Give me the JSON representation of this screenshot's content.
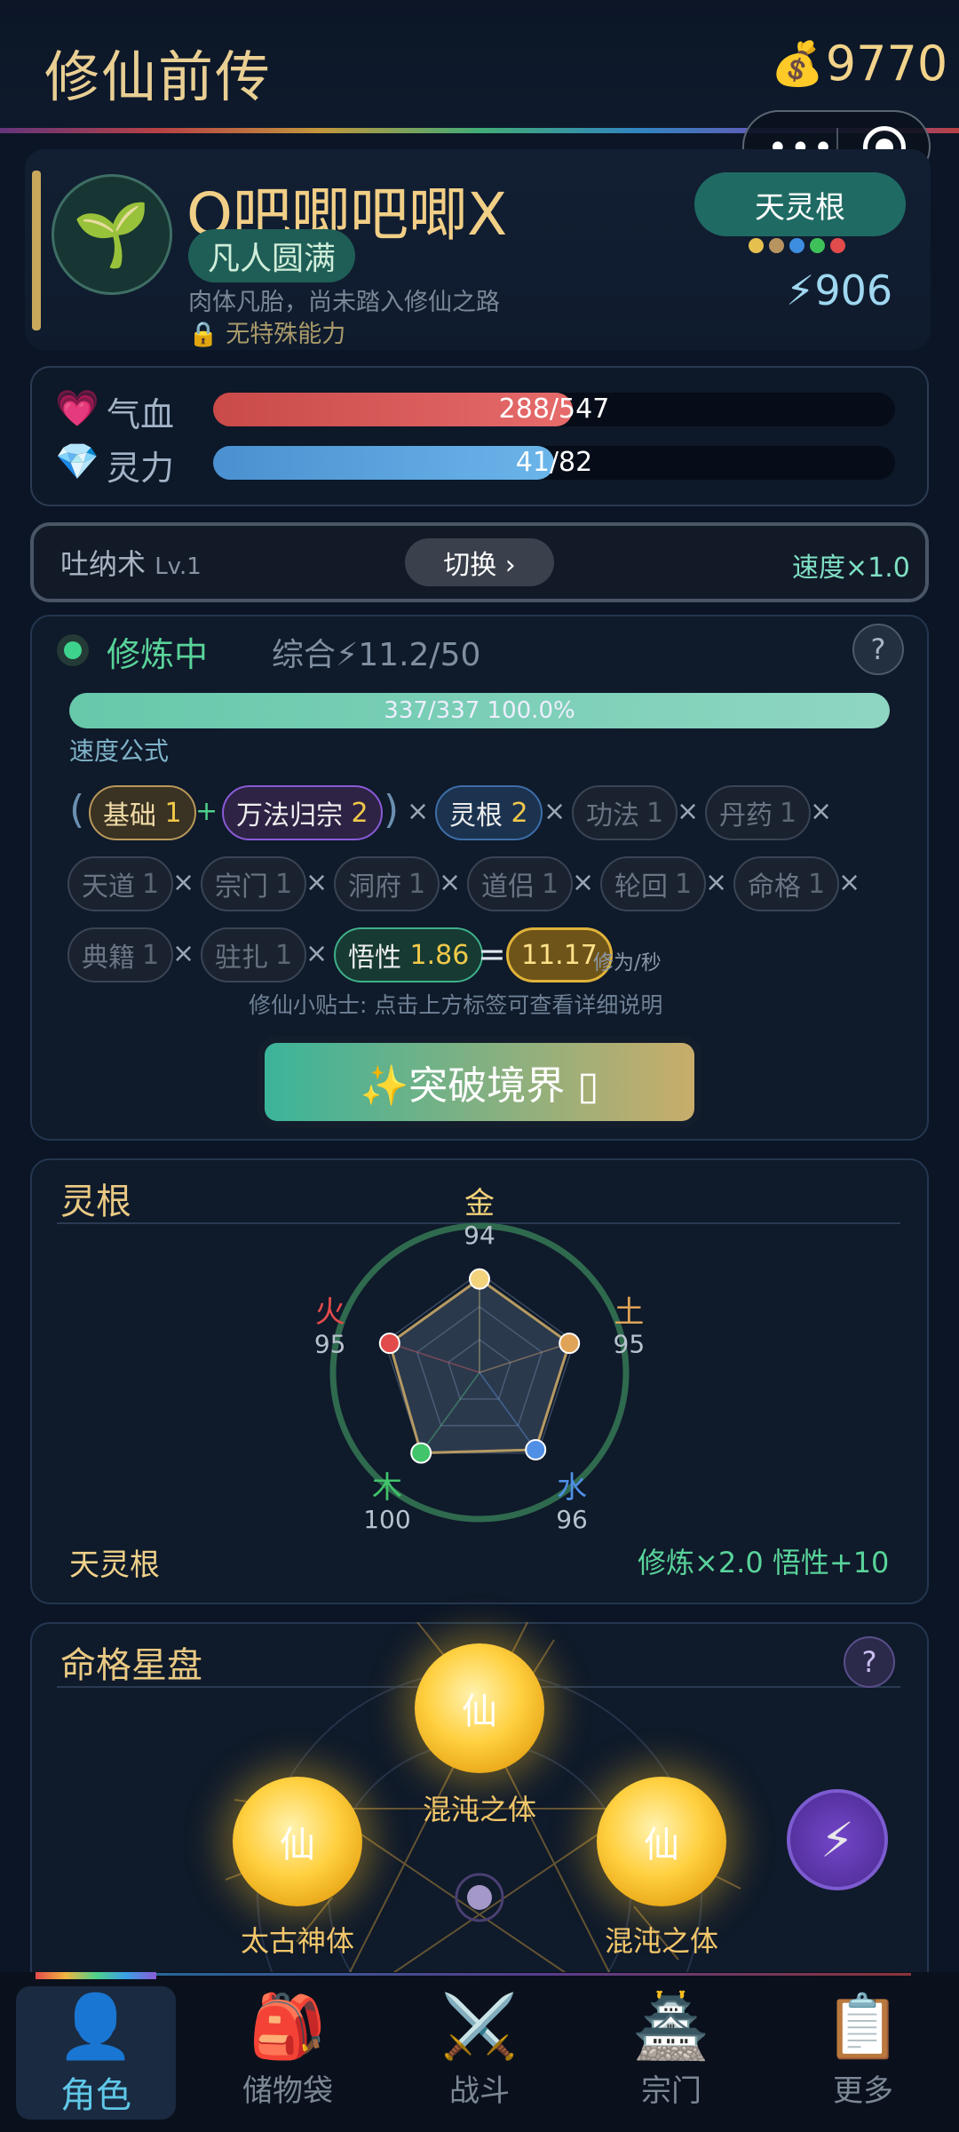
{
  "header": {
    "title": "修仙前传",
    "coins": "9770",
    "coin_icon": "money-bag-icon"
  },
  "player": {
    "name": "O吧唧吧唧X",
    "realm": "凡人圆满",
    "desc": "肉体凡胎，尚未踏入修仙之路",
    "ability": "无特殊能力",
    "linggen_tag": "天灵根",
    "power": "906",
    "dot_colors": [
      "#e5c04f",
      "#b89460",
      "#3d8de0",
      "#3fc15a",
      "#e24b4b"
    ]
  },
  "stats": {
    "hp_label": "气血",
    "hp_text": "288/547",
    "hp_fraction": 0.527,
    "mp_label": "灵力",
    "mp_text": "41/82",
    "mp_fraction": 0.5
  },
  "technique": {
    "name": "吐纳术",
    "level": "Lv.1",
    "switch_label": "切换 ›",
    "speed": "速度×1.0"
  },
  "cultivation": {
    "status": "修炼中",
    "total": "综合⚡11.2/50",
    "help": "?",
    "progress_text": "337/337  100.0%",
    "progress_fraction": 1.0,
    "formula_label": "速度公式",
    "chips": {
      "base": "基础",
      "base_val": "1",
      "wanfa": "万法归宗",
      "wanfa_val": "2",
      "linggen": "灵根",
      "linggen_val": "2",
      "gongfa": "功法",
      "gongfa_val": "1",
      "danyao": "丹药",
      "danyao_val": "1",
      "tiandao": "天道",
      "tiandao_val": "1",
      "zongmen": "宗门",
      "zongmen_val": "1",
      "dongfu": "洞府",
      "dongfu_val": "1",
      "daolv": "道侣",
      "daolv_val": "1",
      "lunhui": "轮回",
      "lunhui_val": "1",
      "mingge": "命格",
      "mingge_val": "1",
      "dianji": "典籍",
      "dianji_val": "1",
      "zhuzha": "驻扎",
      "zhuzha_val": "1",
      "wuxing": "悟性",
      "wuxing_val": "1.86",
      "result": "11.17",
      "unit": "修为/秒"
    },
    "tip": "修仙小贴士: 点击上方标签可查看详细说明",
    "breakthrough": "✨突破境界 ▯"
  },
  "spirit_root": {
    "title": "灵根",
    "name": "天灵根",
    "bonus": "修炼×2.0  悟性+10",
    "elements": [
      {
        "name": "金",
        "value": 94,
        "color": "#f2d27a"
      },
      {
        "name": "土",
        "value": 95,
        "color": "#e0a458"
      },
      {
        "name": "水",
        "value": 96,
        "color": "#4f8fe6"
      },
      {
        "name": "木",
        "value": 100,
        "color": "#41c46a"
      },
      {
        "name": "火",
        "value": 95,
        "color": "#e24b4b"
      }
    ]
  },
  "destiny": {
    "title": "命格星盘",
    "help": "?",
    "orb_char": "仙",
    "orbs": [
      "混沌之体",
      "太古神体",
      "混沌之体"
    ]
  },
  "tabs": [
    {
      "label": "角色",
      "icon": "person-icon",
      "glyph": "👤"
    },
    {
      "label": "储物袋",
      "icon": "backpack-icon",
      "glyph": "🎒"
    },
    {
      "label": "战斗",
      "icon": "crossed-swords-icon",
      "glyph": "⚔️"
    },
    {
      "label": "宗门",
      "icon": "castle-icon",
      "glyph": "🏯"
    },
    {
      "label": "更多",
      "icon": "clipboard-icon",
      "glyph": "📋"
    }
  ]
}
